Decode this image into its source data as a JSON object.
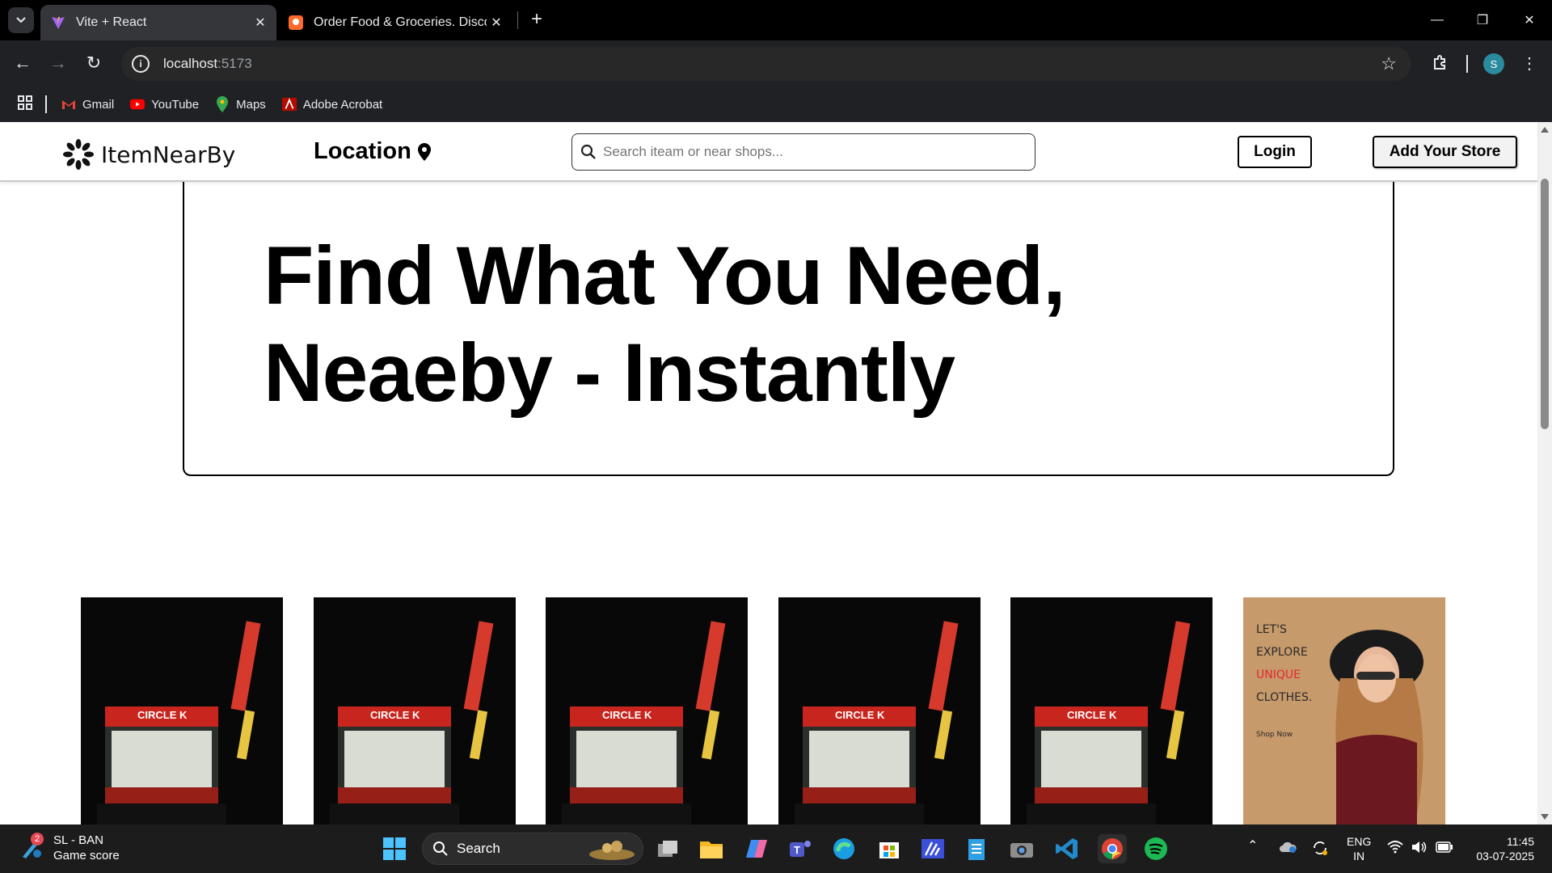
{
  "browser": {
    "tabs": [
      {
        "title": "Vite + React",
        "active": true
      },
      {
        "title": "Order Food & Groceries. Discov",
        "active": false
      }
    ],
    "url_host": "localhost",
    "url_port": ":5173",
    "avatar_letter": "S",
    "bookmarks": [
      "Gmail",
      "YouTube",
      "Maps",
      "Adobe Acrobat"
    ]
  },
  "navbar": {
    "brand": "ItemNearBy",
    "location_label": "Location",
    "search_placeholder": "Search iteam or near shops...",
    "login_label": "Login",
    "add_store_label": "Add Your Store"
  },
  "hero": {
    "title": "Find What You Need, Neaeby - Instantly"
  },
  "cards": [
    {
      "type": "shop-photo",
      "sign": "CIRCLE K"
    },
    {
      "type": "shop-photo",
      "sign": "CIRCLE K"
    },
    {
      "type": "shop-photo",
      "sign": "CIRCLE K"
    },
    {
      "type": "shop-photo",
      "sign": "CIRCLE K"
    },
    {
      "type": "shop-photo",
      "sign": "CIRCLE K"
    },
    {
      "type": "fashion-ad",
      "line1": "LET'S",
      "line2": "EXPLORE",
      "line3": "UNIQUE",
      "line4": "CLOTHES.",
      "cta": "Shop Now"
    }
  ],
  "taskbar": {
    "widget_title": "SL - BAN",
    "widget_sub": "Game score",
    "widget_badge": "2",
    "search_label": "Search",
    "lang_top": "ENG",
    "lang_bottom": "IN",
    "time": "11:45",
    "date": "03-07-2025"
  },
  "colors": {
    "accent_red": "#e6272c",
    "card_bg": "#0a0a0a",
    "ad_bg": "#c69a6a"
  }
}
